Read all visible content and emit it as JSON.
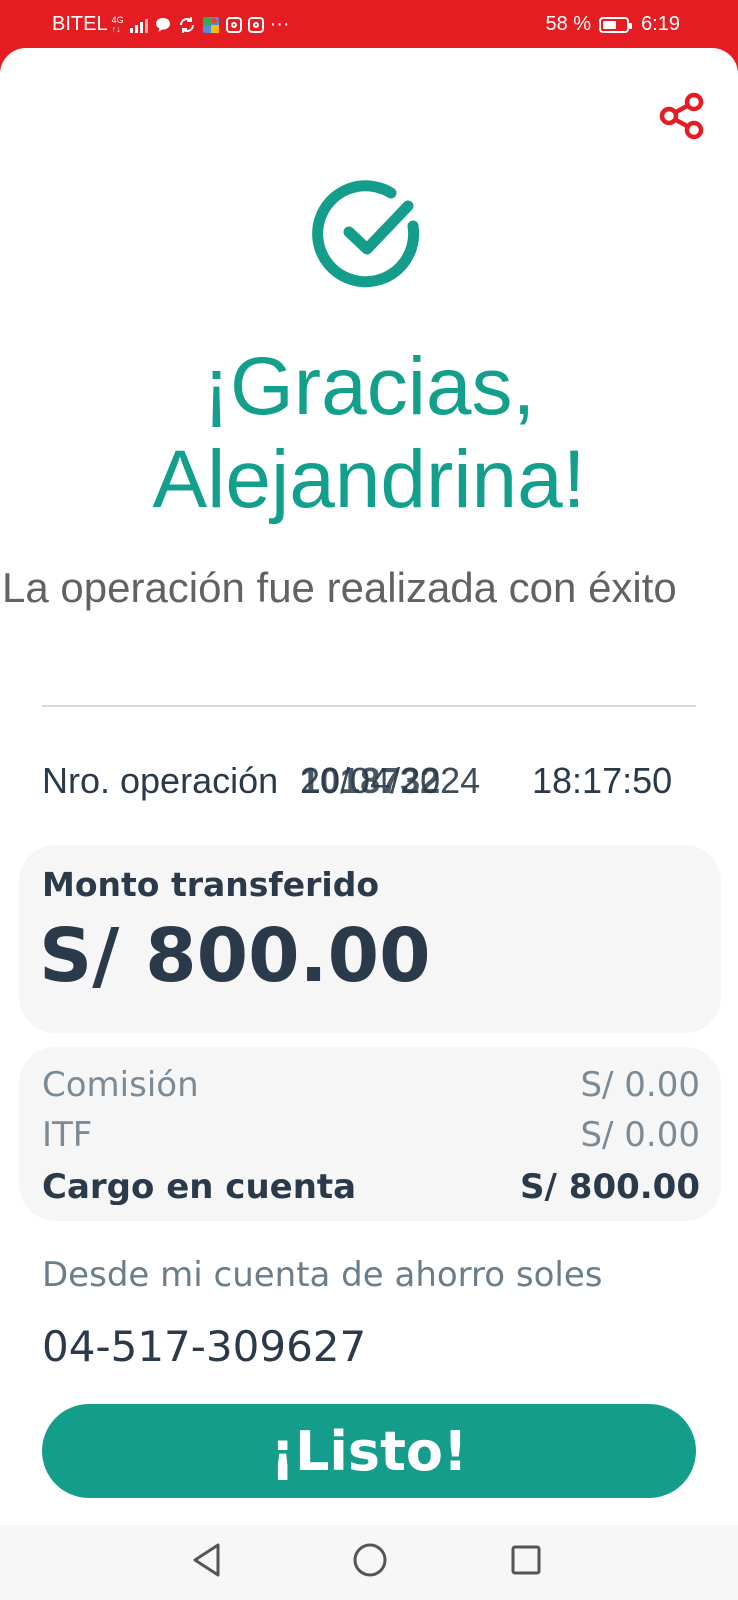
{
  "status_bar": {
    "carrier": "BITEL",
    "network_top": "4G",
    "network_bottom": "↑↓",
    "battery_percent": "58 %",
    "battery_level": 0.58,
    "time": "6:19",
    "more": "···"
  },
  "header": {
    "share_icon": "share-icon",
    "success_icon": "check-circle-icon",
    "title_line1": "¡Gracias,",
    "title_line2": "Alejandrina!",
    "subtitle": "La operación fue realizada con éxito"
  },
  "operation": {
    "label": "Nro. operación",
    "number": "1018732",
    "date": "20/04/2024",
    "time": "18:17:50"
  },
  "amount_card": {
    "label": "Monto transferido",
    "value": "S/ 800.00"
  },
  "details": [
    {
      "label": "Comisión",
      "value": "S/ 0.00"
    },
    {
      "label": "ITF",
      "value": "S/ 0.00"
    },
    {
      "label": "Cargo en cuenta",
      "value": "S/ 800.00"
    }
  ],
  "source": {
    "label": "Desde mi cuenta de ahorro soles",
    "account": "04-517-309627"
  },
  "actions": {
    "done_label": "¡Listo!"
  },
  "colors": {
    "brand_red": "#e51d23",
    "accent_green": "#129f8b",
    "text_dark": "#2a3a4a"
  }
}
